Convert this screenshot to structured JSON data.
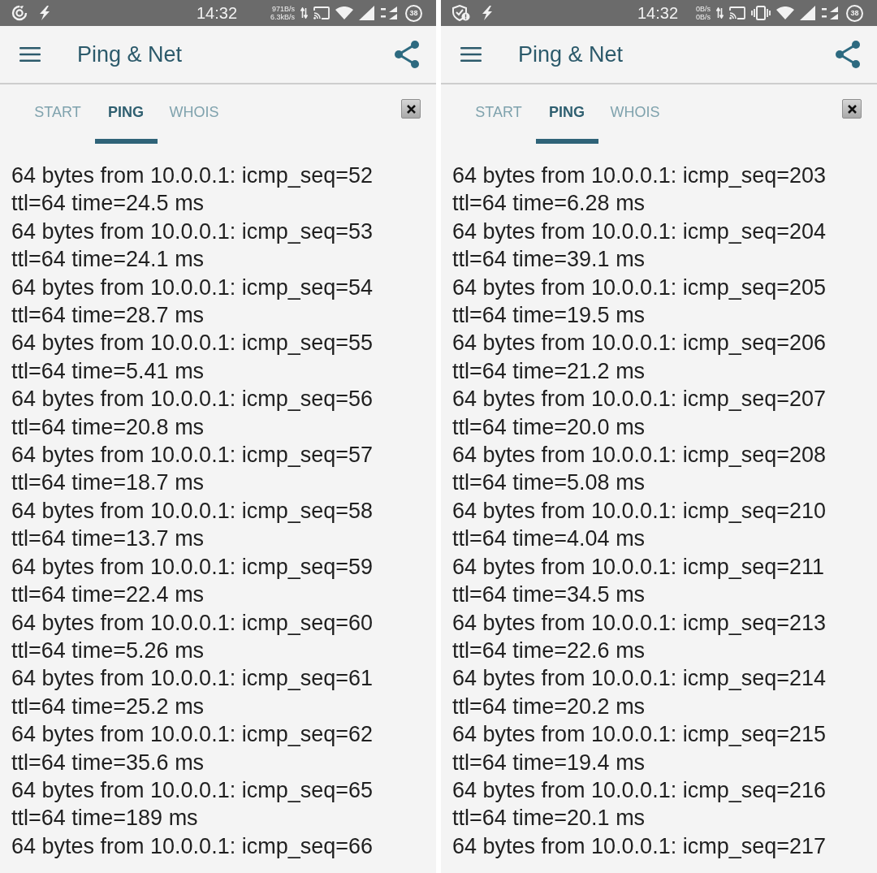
{
  "screens": [
    {
      "status_bar": {
        "notifications": [
          {
            "kind": "swirl"
          },
          {
            "kind": "bolt"
          }
        ],
        "time": "14:32",
        "net_speed": [
          "971B/s",
          "6.3kB/s"
        ],
        "vibrate": false,
        "battery": "38"
      },
      "app_bar": {
        "title": "Ping & Net"
      },
      "tabs": [
        {
          "label": "START",
          "selected": false
        },
        {
          "label": "PING",
          "selected": true
        },
        {
          "label": "WHOIS",
          "selected": false
        }
      ],
      "output_lines": [
        "64 bytes from 10.0.0.1: icmp_seq=52",
        "ttl=64 time=24.5 ms",
        "64 bytes from 10.0.0.1: icmp_seq=53",
        "ttl=64 time=24.1 ms",
        "64 bytes from 10.0.0.1: icmp_seq=54",
        "ttl=64 time=28.7 ms",
        "64 bytes from 10.0.0.1: icmp_seq=55",
        "ttl=64 time=5.41 ms",
        "64 bytes from 10.0.0.1: icmp_seq=56",
        "ttl=64 time=20.8 ms",
        "64 bytes from 10.0.0.1: icmp_seq=57",
        "ttl=64 time=18.7 ms",
        "64 bytes from 10.0.0.1: icmp_seq=58",
        "ttl=64 time=13.7 ms",
        "64 bytes from 10.0.0.1: icmp_seq=59",
        "ttl=64 time=22.4 ms",
        "64 bytes from 10.0.0.1: icmp_seq=60",
        "ttl=64 time=5.26 ms",
        "64 bytes from 10.0.0.1: icmp_seq=61",
        "ttl=64 time=25.2 ms",
        "64 bytes from 10.0.0.1: icmp_seq=62",
        "ttl=64 time=35.6 ms",
        "64 bytes from 10.0.0.1: icmp_seq=65",
        "ttl=64 time=189 ms",
        "64 bytes from 10.0.0.1: icmp_seq=66"
      ]
    },
    {
      "status_bar": {
        "notifications": [
          {
            "kind": "shield"
          },
          {
            "kind": "bolt"
          }
        ],
        "time": "14:32",
        "net_speed": [
          "0B/s",
          "0B/s"
        ],
        "vibrate": true,
        "battery": "38"
      },
      "app_bar": {
        "title": "Ping & Net"
      },
      "tabs": [
        {
          "label": "START",
          "selected": false
        },
        {
          "label": "PING",
          "selected": true
        },
        {
          "label": "WHOIS",
          "selected": false
        }
      ],
      "output_lines": [
        "64 bytes from 10.0.0.1: icmp_seq=203",
        "ttl=64 time=6.28 ms",
        "64 bytes from 10.0.0.1: icmp_seq=204",
        "ttl=64 time=39.1 ms",
        "64 bytes from 10.0.0.1: icmp_seq=205",
        "ttl=64 time=19.5 ms",
        "64 bytes from 10.0.0.1: icmp_seq=206",
        "ttl=64 time=21.2 ms",
        "64 bytes from 10.0.0.1: icmp_seq=207",
        "ttl=64 time=20.0 ms",
        "64 bytes from 10.0.0.1: icmp_seq=208",
        "ttl=64 time=5.08 ms",
        "64 bytes from 10.0.0.1: icmp_seq=210",
        "ttl=64 time=4.04 ms",
        "64 bytes from 10.0.0.1: icmp_seq=211",
        "ttl=64 time=34.5 ms",
        "64 bytes from 10.0.0.1: icmp_seq=213",
        "ttl=64 time=22.6 ms",
        "64 bytes from 10.0.0.1: icmp_seq=214",
        "ttl=64 time=20.2 ms",
        "64 bytes from 10.0.0.1: icmp_seq=215",
        "ttl=64 time=19.4 ms",
        "64 bytes from 10.0.0.1: icmp_seq=216",
        "ttl=64 time=20.1 ms",
        "64 bytes from 10.0.0.1: icmp_seq=217"
      ]
    }
  ]
}
